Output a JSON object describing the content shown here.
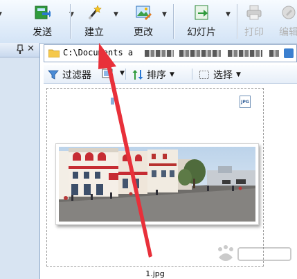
{
  "toolbar": {
    "send_label": "发送",
    "create_label": "建立",
    "change_label": "更改",
    "slideshow_label": "幻灯片",
    "print_label": "打印",
    "edit_label": "编辑"
  },
  "left_panel": {
    "pin_icon": "push-pin-icon",
    "close_icon": "close-icon"
  },
  "address_bar": {
    "path": "C:\\Documents a"
  },
  "view_toolbar": {
    "filter_label": "过滤器",
    "sort_label": "排序",
    "select_label": "选择"
  },
  "thumbnail": {
    "filename": "1.jpg",
    "badge": "JPG"
  },
  "colors": {
    "annotation_arrow": "#e8303a",
    "toolbar_bg": "#dfeaf7",
    "accent": "#3b7fcf"
  }
}
